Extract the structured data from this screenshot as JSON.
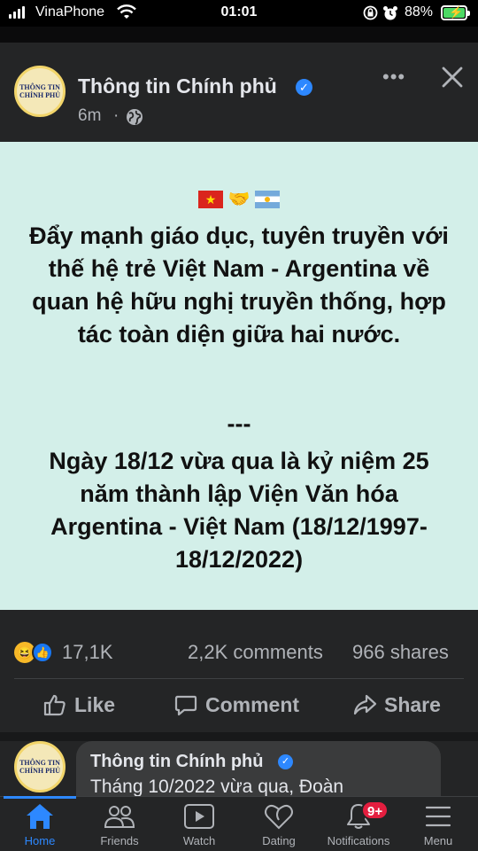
{
  "status_bar": {
    "carrier": "VinaPhone",
    "time": "01:01",
    "battery_percent": "88%"
  },
  "post": {
    "page_name": "Thông tin Chính phủ",
    "avatar_text": [
      "THÔNG TIN",
      "CHÍNH PHỦ"
    ],
    "time_ago": "6m",
    "time_separator": "·",
    "more_label": "•••",
    "headline": "Đẩy mạnh giáo dục, tuyên truyền với thế hệ trẻ Việt Nam - Argentina về quan hệ hữu nghị truyền thống, hợp tác toàn diện giữa hai nước.",
    "divider": "---",
    "subtext": "Ngày 18/12 vừa qua là kỷ niệm 25 năm thành lập Viện Văn hóa Argentina - Việt Nam (18/12/1997-18/12/2022)",
    "colors": {
      "background": "#d3efe9",
      "text": "#111111"
    }
  },
  "stats": {
    "reactions": "17,1K",
    "comments": "2,2K comments",
    "shares": "966 shares"
  },
  "actions": {
    "like": "Like",
    "comment": "Comment",
    "share": "Share"
  },
  "preview": {
    "name": "Thông tin Chính phủ",
    "text": "Tháng 10/2022 vừa qua, Đoàn"
  },
  "bottom_nav": {
    "items": [
      {
        "label": "Home",
        "icon": "home-icon"
      },
      {
        "label": "Friends",
        "icon": "friends-icon"
      },
      {
        "label": "Watch",
        "icon": "watch-icon"
      },
      {
        "label": "Dating",
        "icon": "dating-icon"
      },
      {
        "label": "Notifications",
        "icon": "bell-icon"
      },
      {
        "label": "Menu",
        "icon": "menu-icon"
      }
    ],
    "notification_badge": "9+",
    "accent_color": "#2d88ff"
  }
}
